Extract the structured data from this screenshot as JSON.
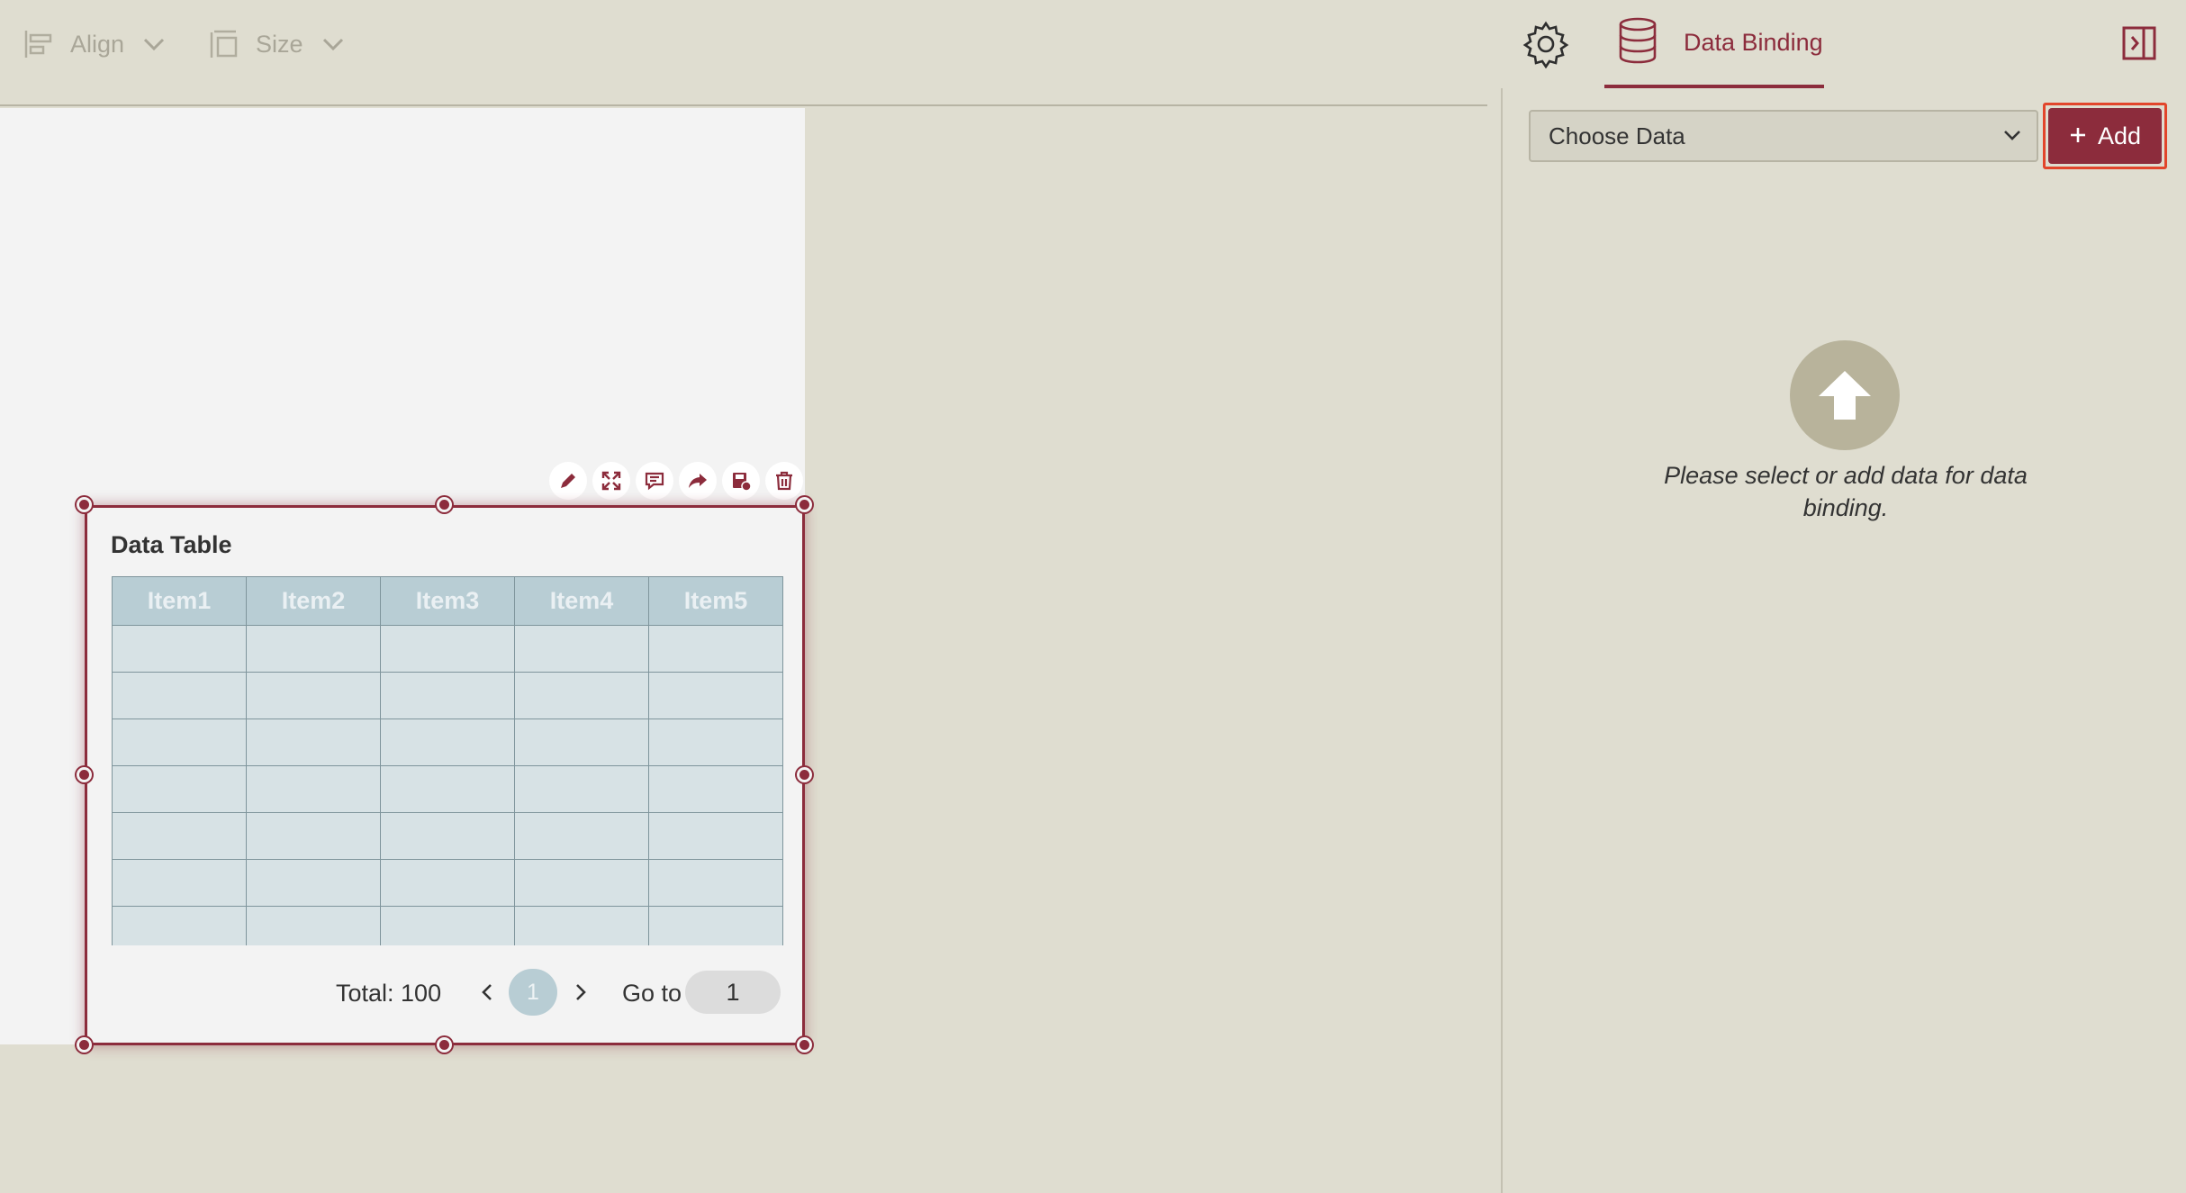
{
  "toolbar": {
    "align_label": "Align",
    "size_label": "Size"
  },
  "right_panel": {
    "tab_label": "Data Binding",
    "choose_data": "Choose Data",
    "add_label": "Add",
    "empty_message": "Please select or add data for data binding."
  },
  "widget": {
    "title": "Data Table",
    "columns": [
      "Item1",
      "Item2",
      "Item3",
      "Item4",
      "Item5"
    ],
    "total": "Total: 100",
    "current_page": "1",
    "goto_label": "Go to",
    "goto_value": "1"
  },
  "colors": {
    "accent": "#8c2c3c",
    "background": "#dfddd0",
    "table_header": "#b8cdd4",
    "table_cell": "#d7e2e5",
    "highlight": "#e2452b"
  }
}
